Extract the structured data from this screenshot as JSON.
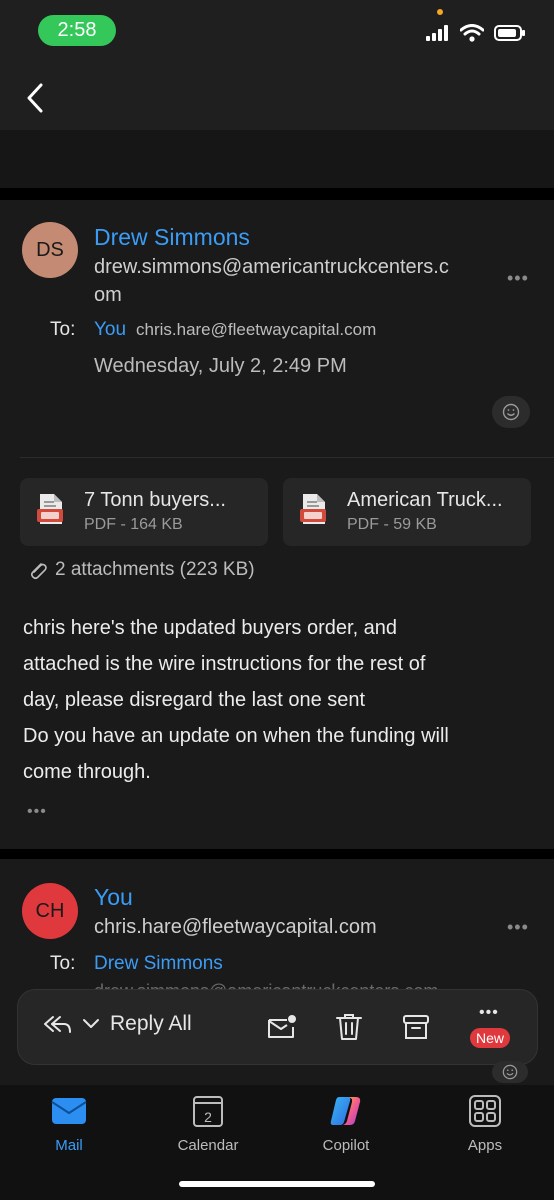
{
  "status_bar": {
    "time": "2:58",
    "icons": [
      "signal-icon",
      "wifi-icon",
      "battery-icon"
    ]
  },
  "nav": {
    "back_icon": "chevron-left-icon"
  },
  "message1": {
    "avatar_initials": "DS",
    "avatar_color": "#c48a73",
    "sender_name": "Drew Simmons",
    "sender_email_line1": "drew.simmons@americantruckcenters.c",
    "sender_email_line2": "om",
    "more": "•••",
    "to_label": "To:",
    "to_you": "You",
    "to_address": "chris.hare@fleetwaycapital.com",
    "date": "Wednesday, July 2, 2:49 PM",
    "attachments": [
      {
        "name": "7 Tonn buyers...",
        "meta": "PDF - 164 KB"
      },
      {
        "name": "American Truck...",
        "meta": "PDF - 59 KB"
      }
    ],
    "attachment_summary": "2 attachments (223 KB)",
    "body_lines": [
      "chris here's the updated buyers order, and",
      "attached is the wire instructions for the rest of",
      "day, please disregard the last one sent",
      "Do you have an update on when the funding will",
      "come through."
    ],
    "body_more": "•••"
  },
  "message2": {
    "avatar_initials": "CH",
    "avatar_color": "#e0393d",
    "sender_name": "You",
    "sender_email": "chris.hare@fleetwaycapital.com",
    "more": "•••",
    "to_label": "To:",
    "to_name": "Drew Simmons",
    "to_address_faded": "drew.simmons@americantruckcenters.com"
  },
  "action_bar": {
    "reply_label": "Reply All",
    "more_dots": "•••",
    "new_badge": "New"
  },
  "tab_bar": {
    "tabs": [
      {
        "label": "Mail",
        "icon": "mail-icon",
        "active": true
      },
      {
        "label": "Calendar",
        "icon": "calendar-icon",
        "day": "2"
      },
      {
        "label": "Copilot",
        "icon": "copilot-icon"
      },
      {
        "label": "Apps",
        "icon": "apps-icon"
      }
    ]
  },
  "colors": {
    "accent": "#3b9cf5",
    "status_pill": "#34c759",
    "badge": "#e0393d"
  }
}
